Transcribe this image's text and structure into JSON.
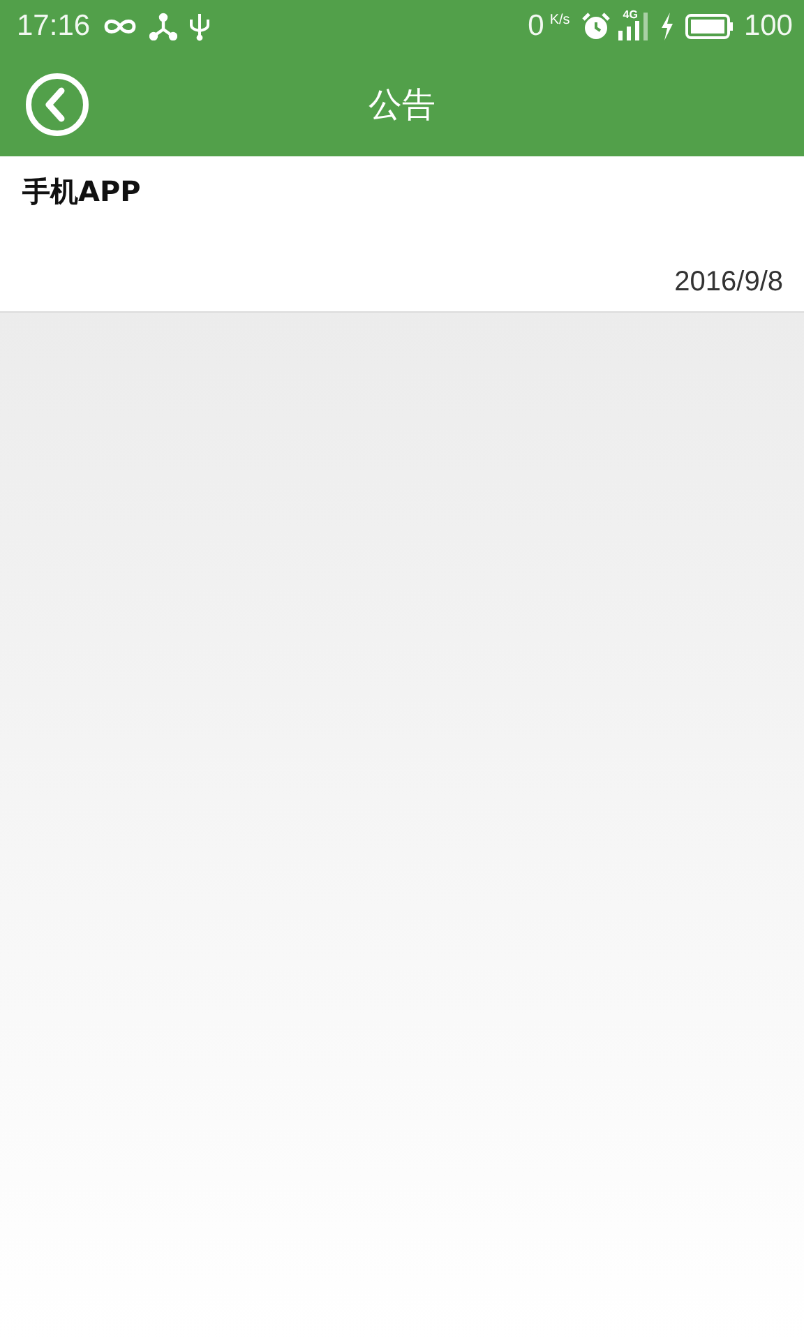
{
  "status_bar": {
    "time": "17:16",
    "speed": "0",
    "speed_unit": "K/s",
    "network": "4G",
    "battery": "100"
  },
  "toolbar": {
    "title": "公告"
  },
  "notices": [
    {
      "title": "手机APP",
      "date": "2016/9/8"
    }
  ]
}
